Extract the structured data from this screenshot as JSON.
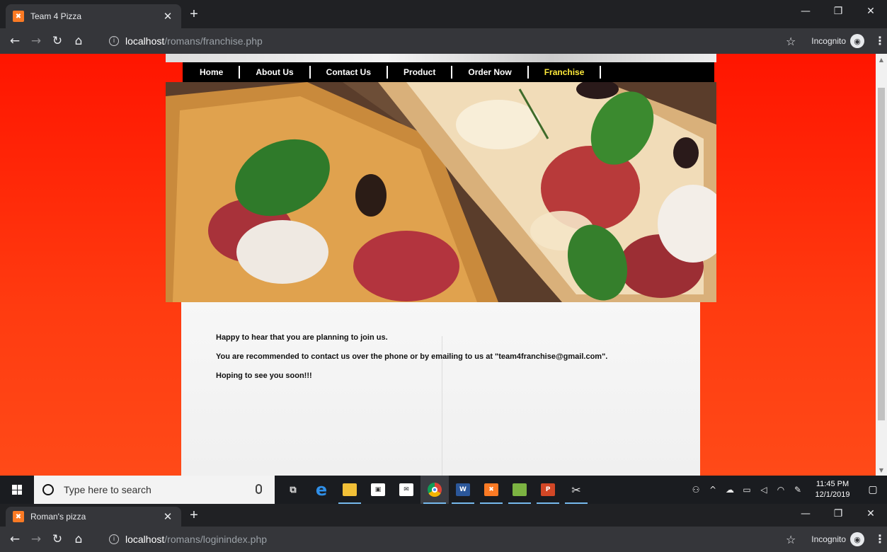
{
  "window1": {
    "tab_title": "Team 4 Pizza",
    "url_host": "localhost",
    "url_path": "/romans/franchise.php",
    "incognito_label": "Incognito",
    "icons": {
      "favicon": "xampp-icon",
      "close": "close-icon",
      "new_tab": "plus-icon",
      "back": "back-arrow-icon",
      "forward": "forward-arrow-icon",
      "reload": "reload-icon",
      "home": "home-icon",
      "info": "info-icon",
      "star": "star-icon",
      "incognito": "incognito-icon",
      "menu": "kebab-menu-icon"
    }
  },
  "site": {
    "nav": [
      {
        "label": "Home"
      },
      {
        "label": "About Us"
      },
      {
        "label": "Contact Us"
      },
      {
        "label": "Product"
      },
      {
        "label": "Order Now"
      },
      {
        "label": "Franchise",
        "active": true
      }
    ],
    "hero_image": "pizza-photo",
    "paragraphs": [
      "Happy to hear that you are planning to join us.",
      "You are recommended to contact us over the phone or by emailing to us at \"team4franchise@gmail.com\".",
      "Hoping to see you soon!!!"
    ],
    "colors": {
      "background": "#ff2200",
      "navbar": "#000000",
      "nav_active": "#ffeb3b",
      "content_bg": "#f4f4f4"
    }
  },
  "taskbar": {
    "search_placeholder": "Type here to search",
    "apps": [
      "task-view-icon",
      "edge-icon",
      "file-explorer-icon",
      "store-icon",
      "mail-icon",
      "chrome-icon",
      "word-icon",
      "xampp-icon",
      "notepad-icon",
      "powerpoint-icon",
      "snipping-icon"
    ],
    "time": "11:45 PM",
    "date": "12/1/2019"
  },
  "window2": {
    "tab_title": "Roman's pizza",
    "url_host": "localhost",
    "url_path": "/romans/loginindex.php",
    "incognito_label": "Incognito"
  }
}
